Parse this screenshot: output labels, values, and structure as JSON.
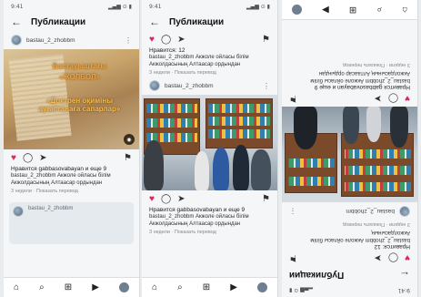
{
  "screen1": {
    "status_left": "9:41",
    "status_right": "▂▄▆ ⊙ ▮",
    "title": "Публикации",
    "author": "bastau_2_zhobbm",
    "photo_lines": [
      "Бастауыштағы",
      "«ЖОЛБОЛ»",
      "«Доктрен оқиміны ауыстанаға сапарлар»"
    ],
    "likes_text": "Нравится gabbasovabayan и еще 9",
    "caption": "bastau_2_zhobbm Акжоле ойласы білім Акжолдасының Алтаасар ордындан",
    "meta": "3 недели · Показать перевод",
    "next_author": "bastau_2_zhobbm"
  },
  "screen2": {
    "status_left": "9:41",
    "status_right": "▂▄▆ ⊙ ▮",
    "title": "Публикации",
    "likes_count": "Нравится: 12",
    "caption_top": "bastau_2_zhobbm Акжоле ойласы білім Акжолдасының Алтаасар ордындан",
    "meta_top": "3 недели · Показать перевод",
    "author": "bastau_2_zhobbm",
    "likes_text": "Нравится gabbasovabayan и еще 9",
    "caption": "bastau_2_zhobbm Акжоле ойласы білім Акжолдасының Алтаасар ордындан",
    "meta": "3 недели · Показать перевод"
  },
  "screen3": {
    "status_left": "9:41",
    "status_right": "▂▄▆ ⊙ ▮",
    "title": "Публикации",
    "likes_count": "Нравится: 12",
    "caption_top": "bastau_2_zhobbm Акжоле ойласы білім Акжолдасының",
    "meta_top": "3 недели · Показать перевод",
    "author": "bastau_2_zhobbm",
    "likes_text": "Нравится gabbasovabayan и еще 9",
    "caption": "bastau_2_zhobbm Акжоле ойласы білім Акжолдасының Алтаасар ордындан",
    "meta": "3 недели · Показать перевод"
  },
  "icons": {
    "back": "←",
    "more": "⋮",
    "heart_filled": "♥",
    "heart": "♡",
    "comment": "◯",
    "share": "➤",
    "save": "⚑",
    "home": "⌂",
    "search": "⌕",
    "add": "⊞",
    "reels": "▶"
  },
  "colors": {
    "heart": "#e0245e",
    "title_orange": "#f2a33a"
  }
}
